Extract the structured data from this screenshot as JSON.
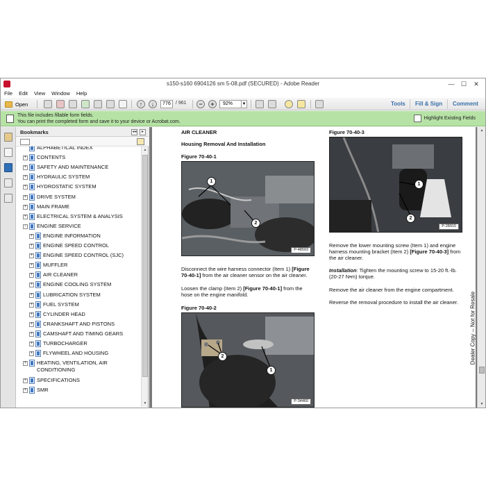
{
  "window": {
    "title": "s150-s160 6904126 sm 5-08.pdf (SECURED) - Adobe Reader",
    "controls": {
      "minimize": "—",
      "maximize": "☐",
      "close": "✕"
    }
  },
  "menu": [
    "File",
    "Edit",
    "View",
    "Window",
    "Help"
  ],
  "toolbar": {
    "open_label": "Open",
    "page_current": "776",
    "page_total": "/ 961",
    "zoom": "92%",
    "zoom_out": "−",
    "zoom_in": "+",
    "tabs": {
      "tools": "Tools",
      "fill_sign": "Fill & Sign",
      "comment": "Comment"
    }
  },
  "notification": {
    "line1": "This file includes fillable form fields.",
    "line2": "You can print the completed form and save it to your device or Acrobat.com.",
    "highlight_button": "Highlight Existing Fields"
  },
  "bookmarks": {
    "title": "Bookmarks",
    "items": [
      {
        "label": "ALPHABETICAL INDEX",
        "level": 0,
        "expander": ""
      },
      {
        "label": "CONTENTS",
        "level": 0,
        "expander": "+"
      },
      {
        "label": "SAFETY AND MAINTENANCE",
        "level": 0,
        "expander": "+"
      },
      {
        "label": "HYDRAULIC SYSTEM",
        "level": 0,
        "expander": "+"
      },
      {
        "label": "HYDROSTATIC SYSTEM",
        "level": 0,
        "expander": "+"
      },
      {
        "label": "DRIVE SYSTEM",
        "level": 0,
        "expander": "+"
      },
      {
        "label": "MAIN FRAME",
        "level": 0,
        "expander": "+"
      },
      {
        "label": "ELECTRICAL SYSTEM & ANALYSIS",
        "level": 0,
        "expander": "+"
      },
      {
        "label": "ENGINE SERVICE",
        "level": 0,
        "expander": "−"
      },
      {
        "label": "ENGINE INFORMATION",
        "level": 1,
        "expander": "+"
      },
      {
        "label": "ENGINE SPEED CONTROL",
        "level": 1,
        "expander": "+"
      },
      {
        "label": "ENGINE SPEED CONTROL (SJC)",
        "level": 1,
        "expander": "+"
      },
      {
        "label": "MUFFLER",
        "level": 1,
        "expander": "+"
      },
      {
        "label": "AIR CLEANER",
        "level": 1,
        "expander": "+"
      },
      {
        "label": "ENGINE COOLING SYSTEM",
        "level": 1,
        "expander": "+"
      },
      {
        "label": "LUBRICATION SYSTEM",
        "level": 1,
        "expander": "+"
      },
      {
        "label": "FUEL SYSTEM",
        "level": 1,
        "expander": "+"
      },
      {
        "label": "CYLINDER HEAD",
        "level": 1,
        "expander": "+"
      },
      {
        "label": "CRANKSHAFT AND PISTONS",
        "level": 1,
        "expander": "+"
      },
      {
        "label": "CAMSHAFT AND TIMING GEARS",
        "level": 1,
        "expander": "+"
      },
      {
        "label": "TURBOCHARGER",
        "level": 1,
        "expander": "+"
      },
      {
        "label": "FLYWHEEL AND HOUSING",
        "level": 1,
        "expander": "+"
      },
      {
        "label": "HEATING, VENTILATION, AIR",
        "label2": "CONDITIONING",
        "level": 0,
        "expander": "+"
      },
      {
        "label": "SPECIFICATIONS",
        "level": 0,
        "expander": "+"
      },
      {
        "label": "SMR",
        "level": 0,
        "expander": "+"
      }
    ]
  },
  "document": {
    "section_title": "AIR CLEANER",
    "subsection_title": "Housing Removal And Installation",
    "fig1_caption": "Figure 70-40-1",
    "fig1_id": "P-48593",
    "para1_a": "Disconnect the wire harness connector (Item 1) ",
    "para1_ref": "[Figure 70-40-1]",
    "para1_b": " from the air cleaner sensor on the air cleaner.",
    "para2_a": "Loosen the clamp (Item 2) ",
    "para2_ref": "[Figure 70-40-1]",
    "para2_b": " from the hose on the engine manifold.",
    "fig2_caption": "Figure 70-40-2",
    "fig2_id": "P-34460",
    "fig3_caption": "Figure 70-40-3",
    "fig3_id": "P-28915",
    "para3_a": "Remove the lower mounting screw (Item 1) and engine harness mounting bracket (Item 2) ",
    "para3_ref": "[Figure 70-40-3]",
    "para3_b": " from the air cleaner.",
    "para4_label": "Installation",
    "para4_text": ": Tighten the mounting screw to 15-20 ft.-lb. (20-27 N•m) torque.",
    "para5": "Remove the air cleaner from the engine compartment.",
    "para6": "Reverse the removal procedure to install the air cleaner.",
    "side_note": "Dealer Copy -- Not for Resale",
    "callouts": {
      "one": "1",
      "two": "2"
    }
  },
  "icons": [
    "adobe-reader-icon",
    "folder-icon",
    "print-icon",
    "email-icon",
    "arrow-up-icon",
    "arrow-down-icon",
    "zoom-out-icon",
    "zoom-in-icon",
    "bookmark-icon",
    "page-thumbnail-icon",
    "attachment-icon",
    "signature-icon",
    "lock-icon"
  ]
}
